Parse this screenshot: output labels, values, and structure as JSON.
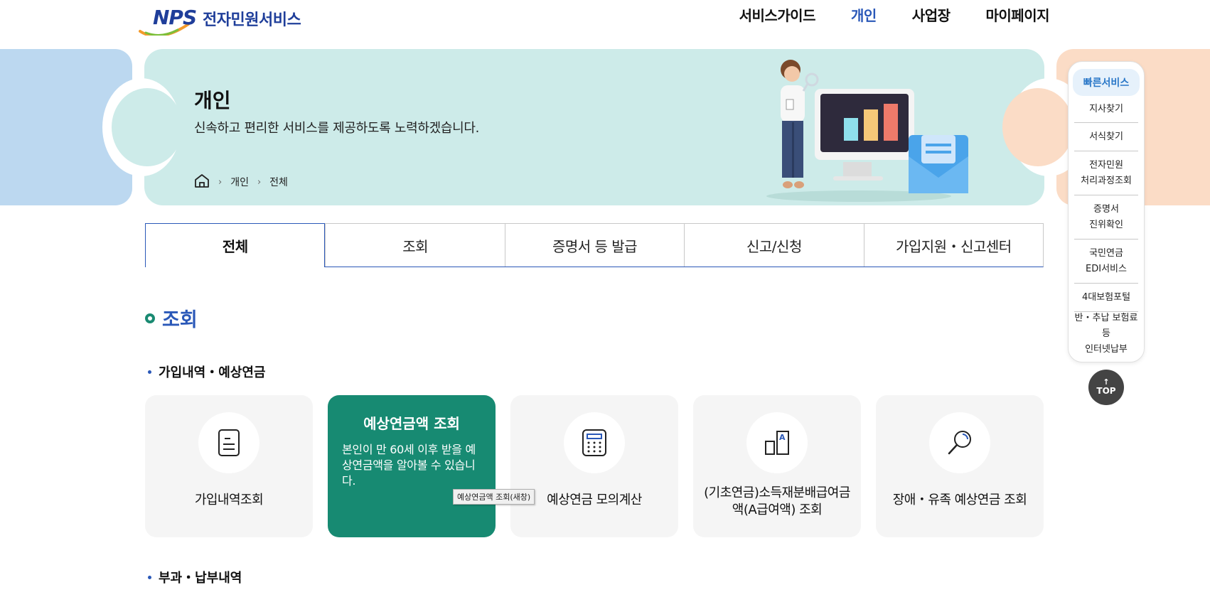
{
  "header": {
    "logo_mark": "NPS",
    "logo_title": "전자민원서비스",
    "nav": [
      "서비스가이드",
      "개인",
      "사업장",
      "마이페이지"
    ],
    "active_nav": "개인"
  },
  "banner": {
    "title": "개인",
    "description": "신속하고 편리한 서비스를 제공하도록 노력하겠습니다.",
    "breadcrumb": [
      "개인",
      "전체"
    ]
  },
  "tabs": [
    "전체",
    "조회",
    "증명서 등 발급",
    "신고/신청",
    "가입지원・신고센터"
  ],
  "section": {
    "title": "조회",
    "group1": "가입내역・예상연금",
    "group2": "부과・납부내역"
  },
  "cards": [
    {
      "label": "가입내역조회",
      "icon": "document-icon"
    },
    {
      "title": "예상연금액 조회",
      "description": "본인이 만 60세 이후 받을 예상연금액을 알아볼 수 있습니다."
    },
    {
      "label": "예상연금 모의계산",
      "icon": "calculator-icon"
    },
    {
      "label": "(기초연금)소득재분배급여금액(A급여액) 조회",
      "icon": "bar-a-icon"
    },
    {
      "label": "장애・유족 예상연금 조회",
      "icon": "magnifier-icon"
    }
  ],
  "tooltip": "예상연금액 조회(새창)",
  "quick": {
    "title": "빠른서비스",
    "items": [
      "지사찾기",
      "서식찾기",
      "전자민원\n처리과정조회",
      "증명서\n진위확인",
      "국민연금\nEDI서비스",
      "4대보험포털",
      "반・추납 보험료등\n인터넷납부"
    ]
  },
  "top_button": "TOP"
}
